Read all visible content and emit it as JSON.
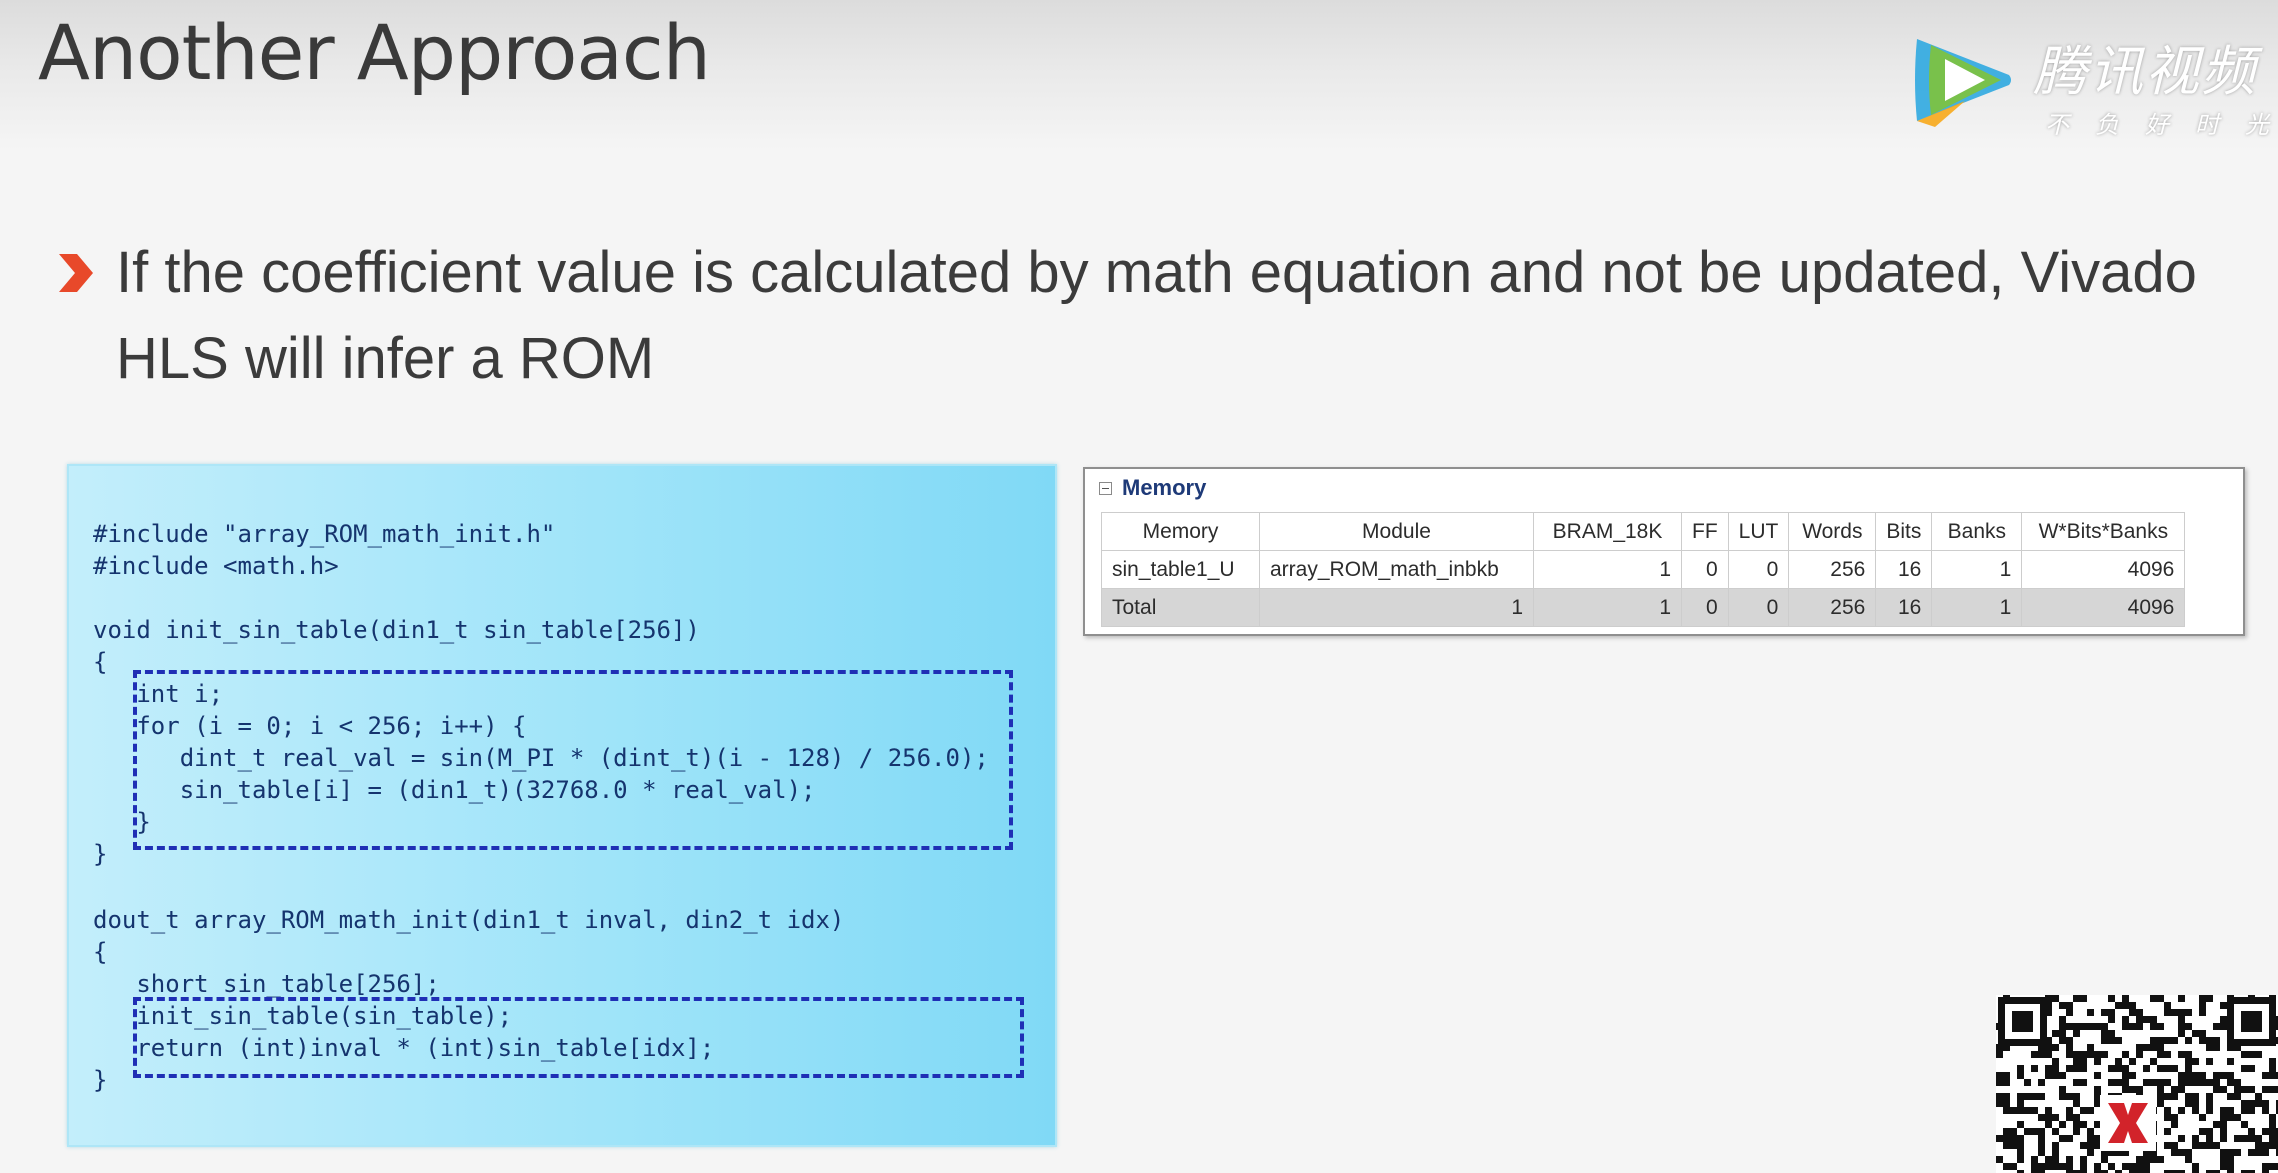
{
  "slide": {
    "title": "Another Approach",
    "bullet": "If the coefficient value is calculated by math equation and not be updated, Vivado HLS will infer a ROM"
  },
  "watermark": {
    "name": "腾讯视频",
    "slogan": "不负好时光"
  },
  "code": {
    "lines": [
      "#include \"array_ROM_math_init.h\"",
      "#include <math.h>",
      "",
      "void init_sin_table(din1_t sin_table[256])",
      "{",
      "   int i;",
      "   for (i = 0; i < 256; i++) {",
      "      dint_t real_val = sin(M_PI * (dint_t)(i - 128) / 256.0);",
      "      sin_table[i] = (din1_t)(32768.0 * real_val);",
      "   }",
      "}",
      "",
      "dout_t array_ROM_math_init(din1_t inval, din2_t idx)",
      "{",
      "   short sin_table[256];",
      "   init_sin_table(sin_table);",
      "   return (int)inval * (int)sin_table[idx];",
      "}"
    ]
  },
  "memory_report": {
    "title": "Memory",
    "columns": [
      "Memory",
      "Module",
      "BRAM_18K",
      "FF",
      "LUT",
      "Words",
      "Bits",
      "Banks",
      "W*Bits*Banks"
    ],
    "rows": [
      [
        "sin_table1_U",
        "array_ROM_math_inbkb",
        "1",
        "0",
        "0",
        "256",
        "16",
        "1",
        "4096"
      ]
    ],
    "total": [
      "Total",
      "1",
      "1",
      "0",
      "0",
      "256",
      "16",
      "1",
      "4096"
    ]
  },
  "colors": {
    "bullet": "#e8492a",
    "code_text": "#15346e",
    "highlight_dash": "#1f2fb5",
    "code_bg": "#9fe4f9"
  }
}
